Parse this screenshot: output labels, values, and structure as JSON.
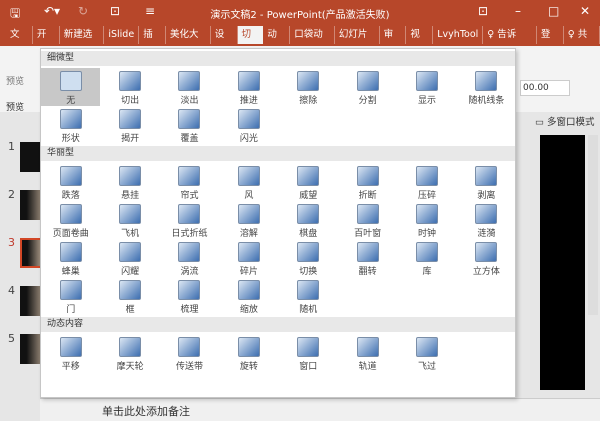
{
  "title": "演示文稿2 - PowerPoint(产品激活失败)",
  "tabs": [
    "文件",
    "开始",
    "新建选项",
    "iSlide",
    "插入",
    "美化大师",
    "设计",
    "切换",
    "动画",
    "口袋动画",
    "幻灯片放",
    "审阅",
    "视图",
    "LvyhTool",
    "♀ 告诉我...",
    "登录",
    "♀ 共享"
  ],
  "active_tab": "切换",
  "ribbon": {
    "preview": "预览",
    "preview_group": "预览",
    "duration": "00.00",
    "multi_window": "多窗口模式"
  },
  "slides": [
    "1",
    "2",
    "3",
    "4",
    "5"
  ],
  "current_slide": "3",
  "notes_placeholder": "单击此处添加备注",
  "gallery": [
    {
      "section": "细微型",
      "items": [
        "无",
        "切出",
        "淡出",
        "推进",
        "擦除",
        "分割",
        "显示",
        "随机线条",
        "形状",
        "揭开",
        "覆盖",
        "闪光"
      ]
    },
    {
      "section": "华丽型",
      "items": [
        "跌落",
        "悬挂",
        "帘式",
        "风",
        "威望",
        "折断",
        "压碎",
        "剥离",
        "页面卷曲",
        "飞机",
        "日式折纸",
        "溶解",
        "棋盘",
        "百叶窗",
        "时钟",
        "涟漪",
        "蜂巢",
        "闪耀",
        "涡流",
        "碎片",
        "切换",
        "翻转",
        "库",
        "立方体",
        "门",
        "框",
        "梳理",
        "缩放",
        "随机"
      ]
    },
    {
      "section": "动态内容",
      "items": [
        "平移",
        "摩天轮",
        "传送带",
        "旋转",
        "窗口",
        "轨道",
        "飞过"
      ]
    }
  ],
  "selected_item": "无"
}
